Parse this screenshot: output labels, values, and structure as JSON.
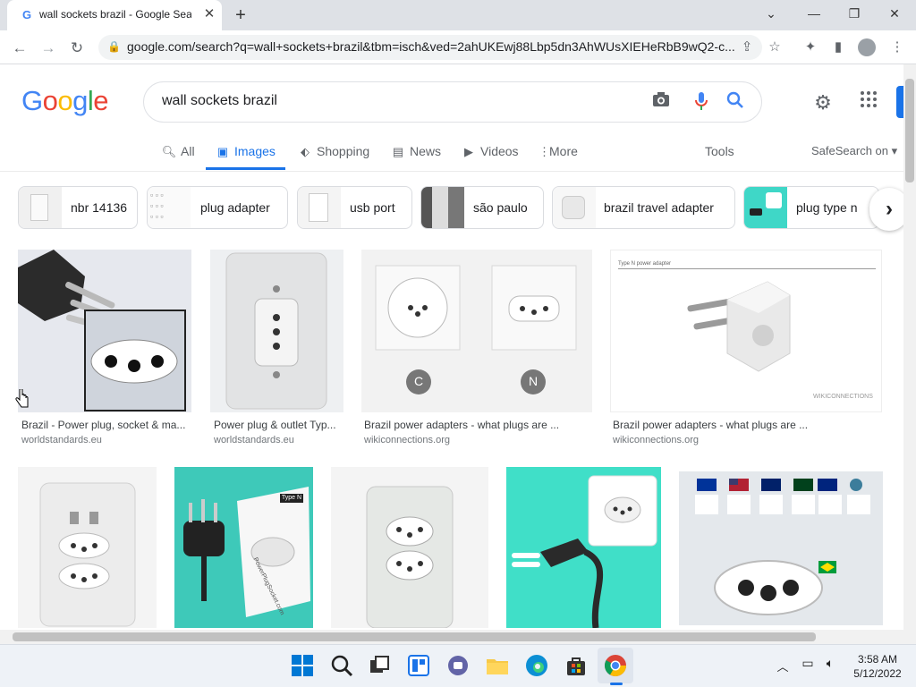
{
  "browser": {
    "tab_title": "wall sockets brazil - Google Search",
    "tab_favicon": "G",
    "url": "google.com/search?q=wall+sockets+brazil&tbm=isch&ved=2ahUKEwj88Lbp5dn3AhWUsXIEHeRbB9wQ2-c..."
  },
  "google": {
    "logo": [
      "G",
      "o",
      "o",
      "g",
      "l",
      "e"
    ],
    "logo_colors": [
      "#4285f4",
      "#ea4335",
      "#fbbc05",
      "#4285f4",
      "#34a853",
      "#ea4335"
    ],
    "query": "wall sockets brazil"
  },
  "nav": {
    "all": "All",
    "images": "Images",
    "shopping": "Shopping",
    "news": "News",
    "videos": "Videos",
    "more": "More",
    "tools": "Tools",
    "safesearch": "SafeSearch on"
  },
  "chips": [
    {
      "label": "nbr 14136"
    },
    {
      "label": "plug adapter"
    },
    {
      "label": "usb port"
    },
    {
      "label": "são paulo"
    },
    {
      "label": "brazil travel adapter"
    },
    {
      "label": "plug type n"
    }
  ],
  "results_row1": [
    {
      "caption": "Brazil - Power plug, socket & ma...",
      "domain": "worldstandards.eu"
    },
    {
      "caption": "Power plug & outlet Typ...",
      "domain": "worldstandards.eu"
    },
    {
      "caption": "Brazil power adapters - what plugs are ...",
      "domain": "wikiconnections.org",
      "badges": [
        "C",
        "N"
      ]
    },
    {
      "caption": "Brazil power adapters - what plugs are ...",
      "domain": "wikiconnections.org",
      "image_text": "Type N power adapter",
      "watermark": "WIKICONNECTIONS"
    }
  ],
  "results_row2": [
    {
      "id": "usb-outlet"
    },
    {
      "id": "type-n-plug",
      "image_text": [
        "Type",
        "N",
        "PowerPlugSocket.com"
      ]
    },
    {
      "id": "double-outlet"
    },
    {
      "id": "plug-teal"
    },
    {
      "id": "infographic"
    }
  ],
  "taskbar": {
    "time": "3:58 AM",
    "date": "5/12/2022"
  }
}
